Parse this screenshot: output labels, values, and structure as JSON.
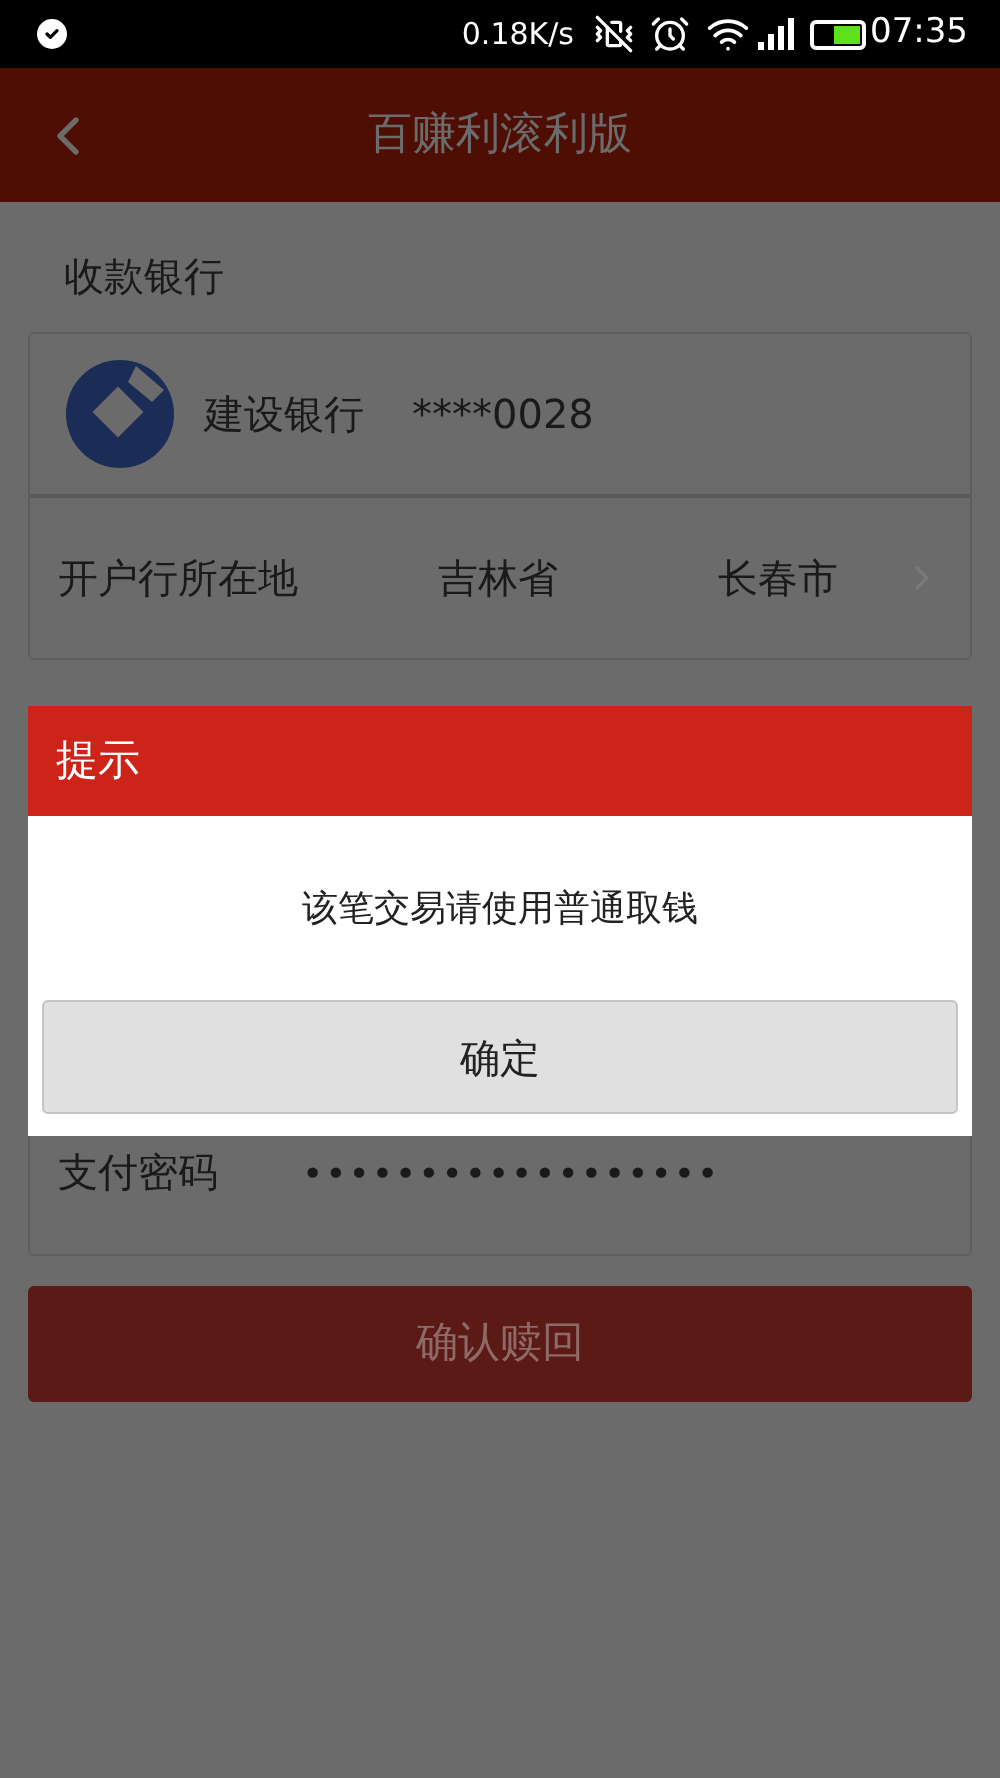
{
  "status_bar": {
    "speed": "0.18K/s",
    "time": "07:35"
  },
  "header": {
    "title": "百赚利滚利版"
  },
  "bank_section": {
    "label": "收款银行",
    "bank_name": "建设银行",
    "card_number": "****0028",
    "location_label": "开户行所在地",
    "province": "吉林省",
    "city": "长春市"
  },
  "password": {
    "label": "支付密码",
    "value": "••••••••••••••••••"
  },
  "confirm_button": {
    "label": "确认赎回"
  },
  "dialog": {
    "title": "提示",
    "message": "该笔交易请使用普通取钱",
    "button": "确定"
  }
}
